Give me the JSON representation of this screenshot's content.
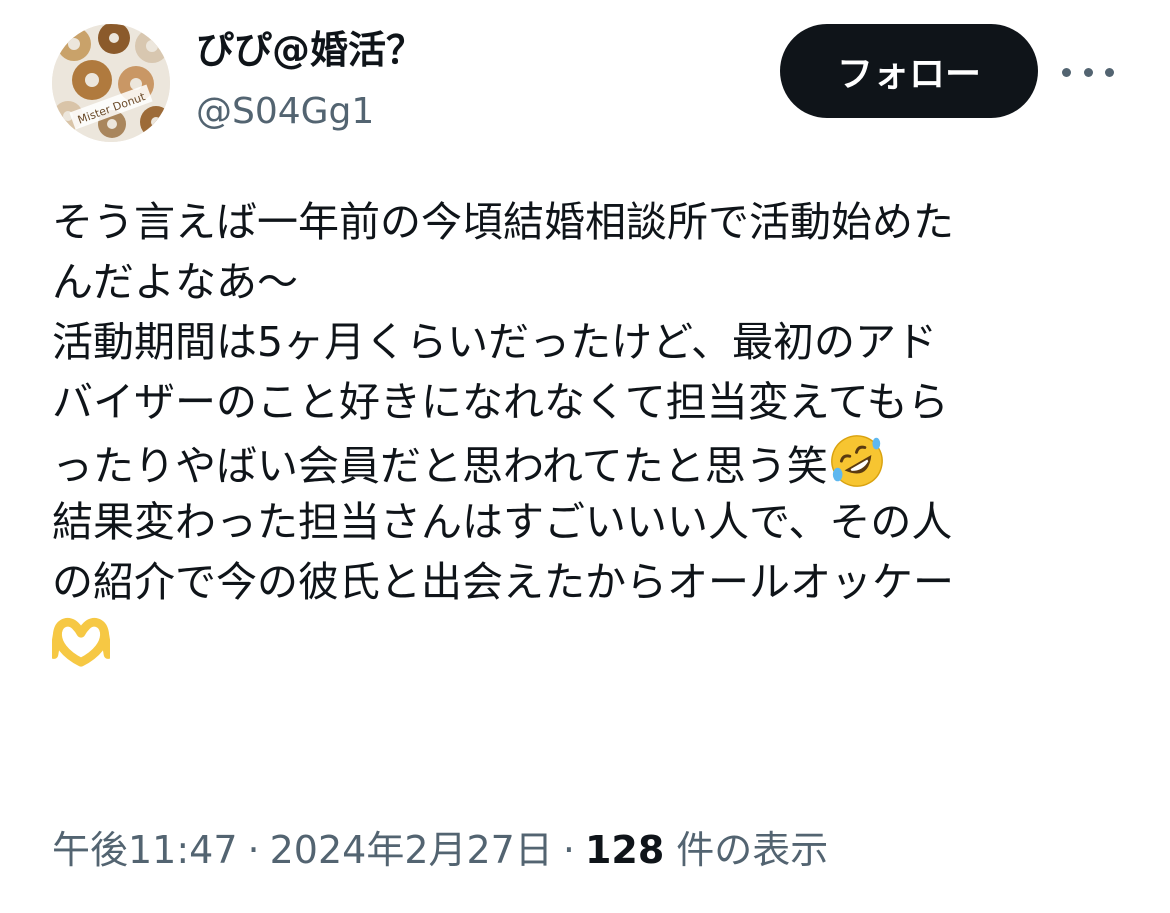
{
  "user": {
    "display_name": "ぴぴ@婚活？",
    "handle": "@S04Gg1",
    "avatar_text": "Mister Donut"
  },
  "actions": {
    "follow_label": "フォロー",
    "more_icon": "more-horizontal-icon"
  },
  "tweet": {
    "lines": [
      "そう言えば一年前の今頃結婚相談所で活動始めた",
      "んだよなあ〜",
      "活動期間は5ヶ月くらいだったけど、最初のアド",
      "バイザーのこと好きになれなくて担当変えてもら",
      "ったりやばい会員だと思われてたと思う笑",
      "結果変わった担当さんはすごいいい人で、その人",
      "の紹介で今の彼氏と出会えたからオールオッケー"
    ],
    "emoji_rofl": "rolling-on-floor-laughing-emoji",
    "emoji_heart_hands": "heart-hands-emoji"
  },
  "meta": {
    "time": "午後11:47",
    "separator": "·",
    "date": "2024年2月27日",
    "views_count": "128",
    "views_label": "件の表示"
  },
  "colors": {
    "text": "#0f1419",
    "secondary": "#536471",
    "button_bg": "#0f1419",
    "button_text": "#ffffff"
  }
}
